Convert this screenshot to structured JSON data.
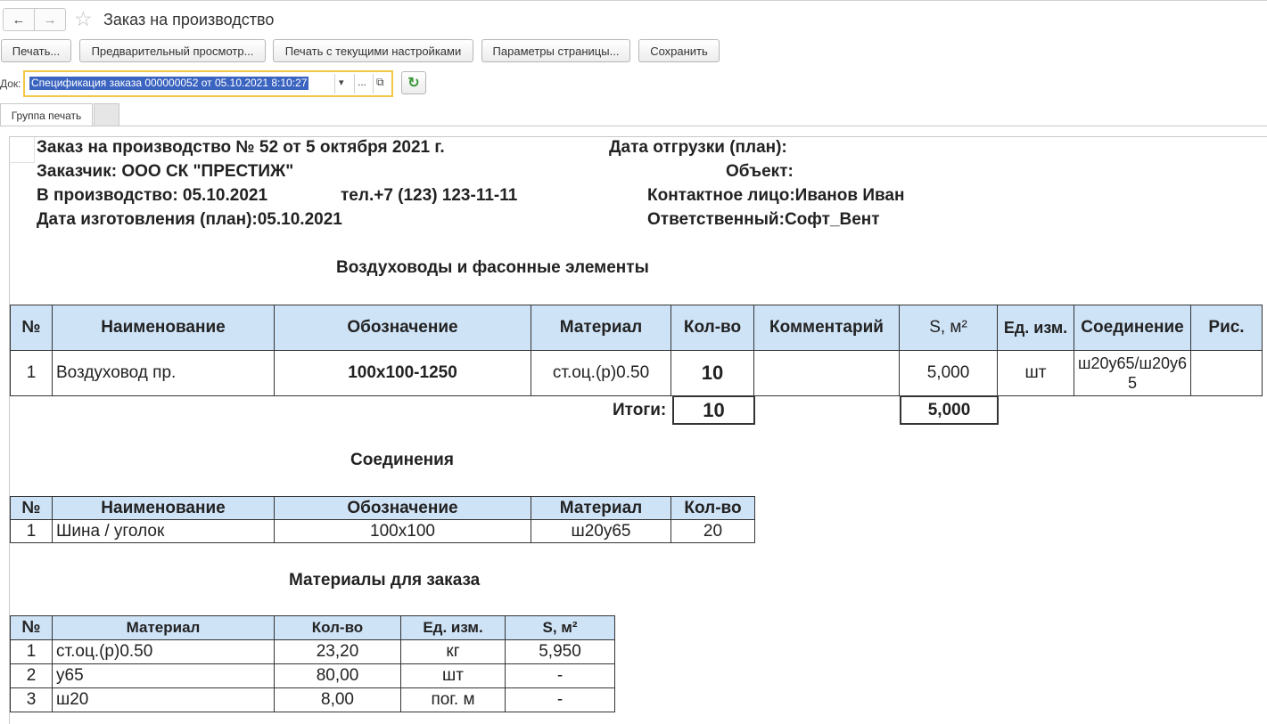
{
  "window": {
    "title": "Заказ на производство",
    "back_icon": "←",
    "forward_icon": "→",
    "star_icon": "☆"
  },
  "toolbar": {
    "print": "Печать...",
    "preview": "Предварительный просмотр...",
    "print_current": "Печать с текущими настройками",
    "page_params": "Параметры страницы...",
    "save": "Сохранить"
  },
  "doc": {
    "label": "Док:",
    "value": "Спецификация заказа 000000052 от 05.10.2021 8:10:27",
    "dropdown_icon": "▾",
    "ellipsis": "...",
    "open_icon": "⧉",
    "refresh_icon": "↻"
  },
  "tabs": [
    "Группа печать",
    ""
  ],
  "report": {
    "header": {
      "order_title": "Заказ на производство № 52 от 5 октября 2021 г.",
      "ship_date": "Дата отгрузки (план):",
      "customer": "Заказчик: ООО СК \"ПРЕСТИЖ\"",
      "object": "Объект:",
      "in_production": "В производство: 05.10.2021",
      "phone": "тел.+7 (123) 123-11-11",
      "contact": "Контактное лицо:Иванов Иван",
      "manufacture_date": "Дата изготовления (план):05.10.2021",
      "responsible": "Ответственный:Софт_Вент"
    },
    "section1": {
      "title": "Воздуховоды и фасонные элементы",
      "columns": [
        "№",
        "Наименование",
        "Обозначение",
        "Материал",
        "Кол-во",
        "Комментарий",
        "S, м²",
        "Ед. изм.",
        "Соединение",
        "Рис."
      ],
      "rows": [
        [
          "1",
          "Воздуховод пр.",
          "100х100-1250",
          "ст.оц.(р)0.50",
          "10",
          "",
          "5,000",
          "шт",
          "ш20у65/ш20у65",
          ""
        ]
      ],
      "totals_label": "Итоги:",
      "total_qty": "10",
      "total_area": "5,000"
    },
    "section2": {
      "title": "Соединения",
      "columns": [
        "№",
        "Наименование",
        "Обозначение",
        "Материал",
        "Кол-во"
      ],
      "rows": [
        [
          "1",
          "Шина / уголок",
          "100х100",
          "ш20у65",
          "20"
        ]
      ]
    },
    "section3": {
      "title": "Материалы для заказа",
      "columns": [
        "№",
        "Материал",
        "Кол-во",
        "Ед. изм.",
        "S, м²"
      ],
      "rows": [
        [
          "1",
          "ст.оц.(р)0.50",
          "23,20",
          "кг",
          "5,950"
        ],
        [
          "2",
          "у65",
          "80,00",
          "шт",
          "-"
        ],
        [
          "3",
          "ш20",
          "8,00",
          "пог. м",
          "-"
        ]
      ]
    }
  }
}
